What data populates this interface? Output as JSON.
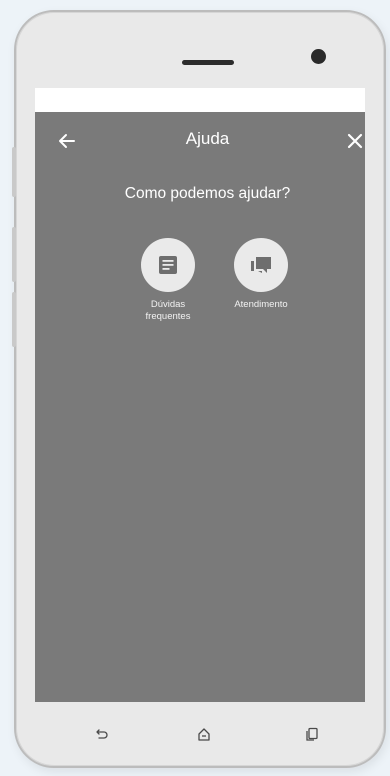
{
  "header": {
    "title": "Ajuda"
  },
  "main": {
    "question": "Como podemos ajudar?",
    "options": [
      {
        "label_line1": "Dúvidas",
        "label_line2": "frequentes",
        "icon": "document-icon"
      },
      {
        "label_line1": "Atendimento",
        "label_line2": "",
        "icon": "chat-bubbles-icon"
      }
    ]
  },
  "icons": {
    "back": "arrow-left-icon",
    "close": "close-icon",
    "nav_back": "back-nav-icon",
    "nav_home": "home-icon",
    "nav_recents": "recents-icon"
  },
  "colors": {
    "screen_background": "#7a7a7a",
    "option_circle": "#eaeaea",
    "icon_dark": "#6e6e6e",
    "text": "#ffffff"
  }
}
